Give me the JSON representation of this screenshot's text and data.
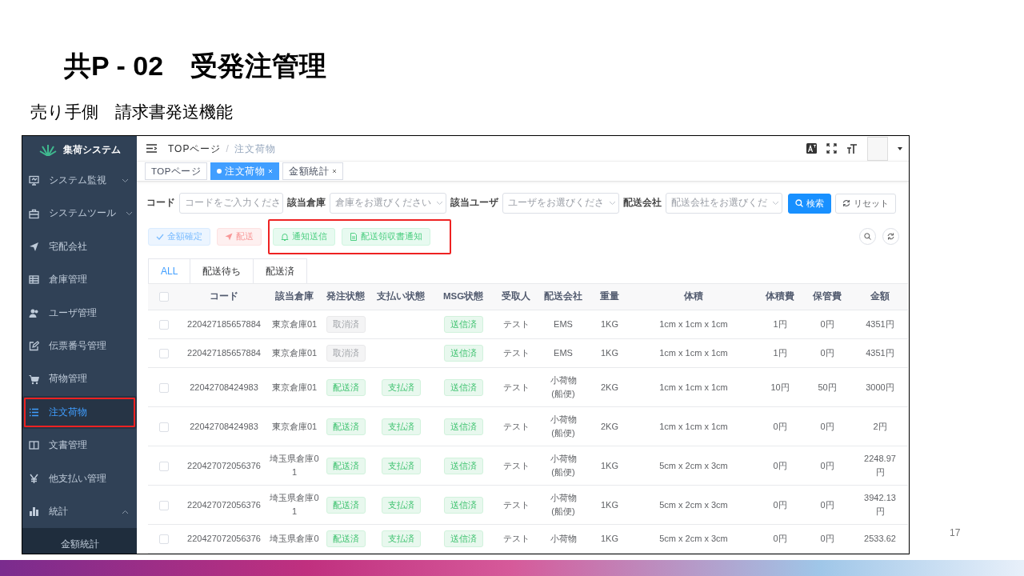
{
  "slide": {
    "title": "共P - 02　受発注管理",
    "subtitle": "売り手側　請求書発送機能",
    "page_number": "17"
  },
  "app": {
    "brand": "集荷システム",
    "sidebar": [
      {
        "label": "システム監視",
        "selected": false,
        "callout": false,
        "expanded": false
      },
      {
        "label": "システムツール",
        "selected": false,
        "callout": false,
        "expanded": false
      },
      {
        "label": "宅配会社",
        "selected": false,
        "callout": false
      },
      {
        "label": "倉庫管理",
        "selected": false,
        "callout": false
      },
      {
        "label": "ユーザ管理",
        "selected": false,
        "callout": false
      },
      {
        "label": "伝票番号管理",
        "selected": false,
        "callout": false
      },
      {
        "label": "荷物管理",
        "selected": false,
        "callout": false
      },
      {
        "label": "注文荷物",
        "selected": true,
        "callout": true
      },
      {
        "label": "文書管理",
        "selected": false,
        "callout": false
      },
      {
        "label": "他支払い管理",
        "selected": false,
        "callout": false
      },
      {
        "label": "統計",
        "selected": false,
        "callout": false,
        "expanded": true,
        "children": [
          {
            "label": "金額統計",
            "selected": false
          }
        ]
      }
    ],
    "breadcrumb": [
      {
        "label": "TOPページ",
        "current": false
      },
      {
        "label": "注文荷物",
        "current": true
      }
    ],
    "breadcrumb_separator": "/",
    "tags": [
      {
        "label": "TOPページ",
        "selected": false,
        "closable": false
      },
      {
        "label": "注文荷物",
        "selected": true,
        "closable": true
      },
      {
        "label": "金額統計",
        "selected": false,
        "closable": true
      }
    ],
    "filters": [
      {
        "label": "コード",
        "kind": "input",
        "placeholder": "コードをご入力くださ"
      },
      {
        "label": "該当倉庫",
        "kind": "select",
        "placeholder": "倉庫をお選びください"
      },
      {
        "label": "該当ユーザ",
        "kind": "select",
        "placeholder": "ユーザをお選びくださ"
      },
      {
        "label": "配送会社",
        "kind": "select",
        "placeholder": "配送会社をお選びくだ"
      }
    ],
    "search_button": "検索",
    "reset_button": "リセット",
    "actions": [
      {
        "label": "金額確定",
        "kind": "info"
      },
      {
        "label": "配送",
        "kind": "danger"
      }
    ],
    "callout_actions": [
      {
        "label": "通知送信",
        "kind": "success"
      },
      {
        "label": "配送領収書通知",
        "kind": "success"
      }
    ],
    "tabs": [
      {
        "label": "ALL",
        "selected": true
      },
      {
        "label": "配送待ち",
        "selected": false
      },
      {
        "label": "配送済",
        "selected": false
      }
    ],
    "table": {
      "all_checked": false,
      "columns": [
        "コード",
        "該当倉庫",
        "発注状態",
        "支払い状態",
        "MSG状態",
        "受取人",
        "配送会社",
        "重量",
        "体積",
        "体積費",
        "保管費",
        "金額"
      ],
      "rows": [
        {
          "checked": false,
          "code": "220427185657884",
          "warehouse": "東京倉庫01",
          "order_status": {
            "text": "取消済",
            "kind": "muted"
          },
          "payment_status": null,
          "msg_status": {
            "text": "送信済",
            "kind": "success"
          },
          "recipient": "テスト",
          "carrier": "EMS",
          "weight": "1KG",
          "volume": "1cm x 1cm x 1cm",
          "volume_fee": "1円",
          "storage_fee": "0円",
          "amount": "4351円"
        },
        {
          "checked": false,
          "code": "220427185657884",
          "warehouse": "東京倉庫01",
          "order_status": {
            "text": "取消済",
            "kind": "muted"
          },
          "payment_status": null,
          "msg_status": {
            "text": "送信済",
            "kind": "success"
          },
          "recipient": "テスト",
          "carrier": "EMS",
          "weight": "1KG",
          "volume": "1cm x 1cm x 1cm",
          "volume_fee": "1円",
          "storage_fee": "0円",
          "amount": "4351円"
        },
        {
          "checked": false,
          "code": "22042708424983",
          "warehouse": "東京倉庫01",
          "order_status": {
            "text": "配送済",
            "kind": "success"
          },
          "payment_status": {
            "text": "支払済",
            "kind": "success"
          },
          "msg_status": {
            "text": "送信済",
            "kind": "success"
          },
          "recipient": "テスト",
          "carrier": "小荷物(船便)",
          "weight": "2KG",
          "volume": "1cm x 1cm x 1cm",
          "volume_fee": "10円",
          "storage_fee": "50円",
          "amount": "3000円"
        },
        {
          "checked": false,
          "code": "22042708424983",
          "warehouse": "東京倉庫01",
          "order_status": {
            "text": "配送済",
            "kind": "success"
          },
          "payment_status": {
            "text": "支払済",
            "kind": "success"
          },
          "msg_status": {
            "text": "送信済",
            "kind": "success"
          },
          "recipient": "テスト",
          "carrier": "小荷物(船便)",
          "weight": "2KG",
          "volume": "1cm x 1cm x 1cm",
          "volume_fee": "0円",
          "storage_fee": "0円",
          "amount": "2円"
        },
        {
          "checked": false,
          "code": "220427072056376",
          "warehouse": "埼玉県倉庫01",
          "order_status": {
            "text": "配送済",
            "kind": "success"
          },
          "payment_status": {
            "text": "支払済",
            "kind": "success"
          },
          "msg_status": {
            "text": "送信済",
            "kind": "success"
          },
          "recipient": "テスト",
          "carrier": "小荷物(船便)",
          "weight": "1KG",
          "volume": "5cm x 2cm x 3cm",
          "volume_fee": "0円",
          "storage_fee": "0円",
          "amount": "2248.97円"
        },
        {
          "checked": false,
          "code": "220427072056376",
          "warehouse": "埼玉県倉庫01",
          "order_status": {
            "text": "配送済",
            "kind": "success"
          },
          "payment_status": {
            "text": "支払済",
            "kind": "success"
          },
          "msg_status": {
            "text": "送信済",
            "kind": "success"
          },
          "recipient": "テスト",
          "carrier": "小荷物(船便)",
          "weight": "1KG",
          "volume": "5cm x 2cm x 3cm",
          "volume_fee": "0円",
          "storage_fee": "0円",
          "amount": "3942.13円"
        },
        {
          "checked": false,
          "code": "220427072056376",
          "warehouse": "埼玉県倉庫0",
          "order_status": {
            "text": "配送済",
            "kind": "success"
          },
          "payment_status": {
            "text": "支払済",
            "kind": "success"
          },
          "msg_status": {
            "text": "送信済",
            "kind": "success"
          },
          "recipient": "テスト",
          "carrier": "小荷物",
          "weight": "1KG",
          "volume": "5cm x 2cm x 3cm",
          "volume_fee": "0円",
          "storage_fee": "0円",
          "amount": "2533.62"
        }
      ]
    }
  }
}
